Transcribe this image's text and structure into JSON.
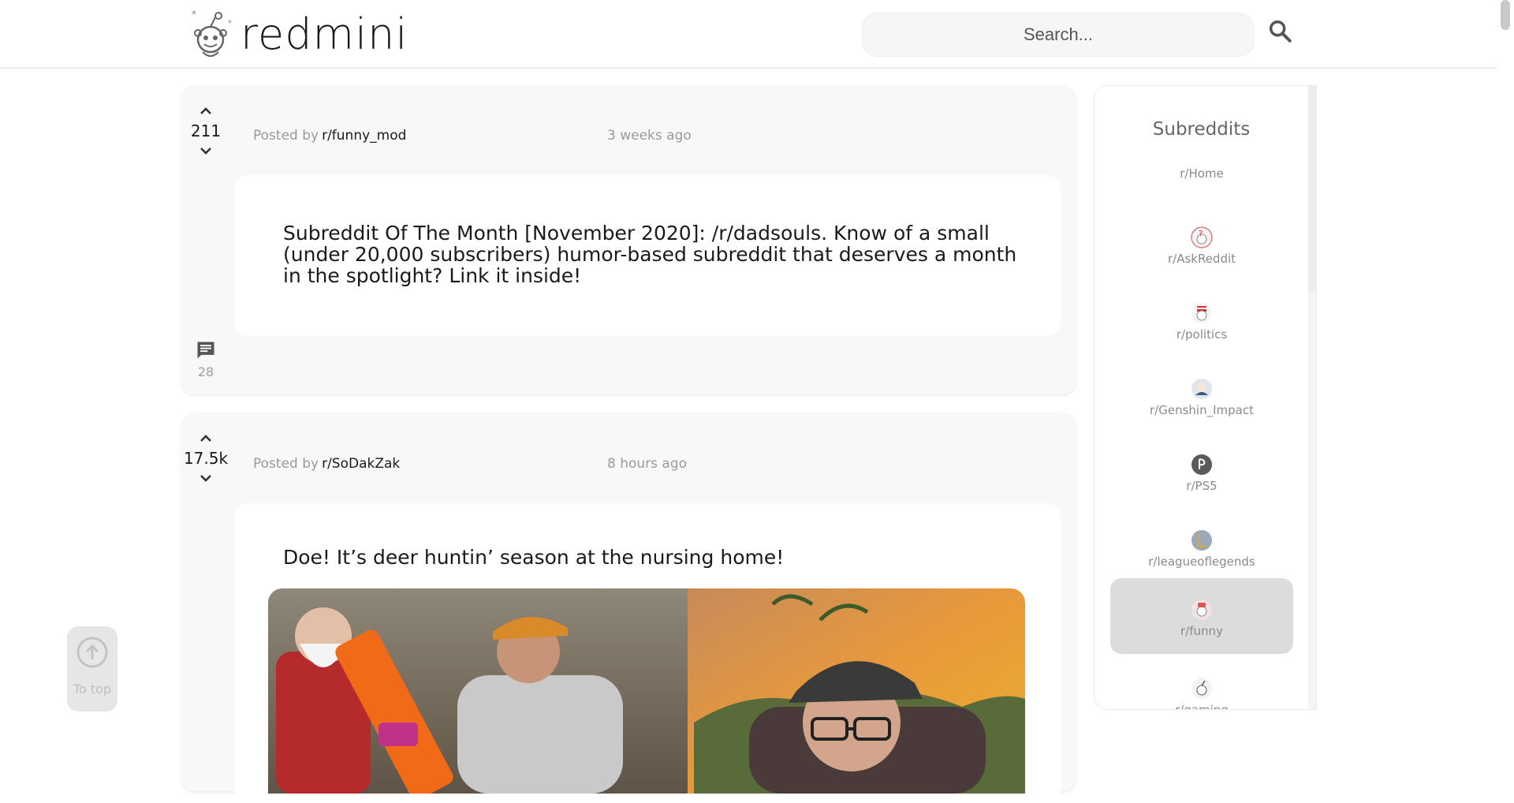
{
  "header": {
    "logo_text": "redmini",
    "search_placeholder": "Search..."
  },
  "posts": [
    {
      "score": "211",
      "posted_by_label": "Posted by",
      "author": "r/funny_mod",
      "time": "3 weeks ago",
      "title": "Subreddit Of The Month [November 2020]: /r/dadsouls. Know of a small (under 20,000 subscribers) humor-based subreddit that deserves a month in the spotlight? Link it inside!",
      "comments": "28"
    },
    {
      "score": "17.5k",
      "posted_by_label": "Posted by",
      "author": "r/SoDakZak",
      "time": "8 hours ago",
      "title": "Doe! It’s deer huntin’ season at the nursing home!"
    }
  ],
  "sidebar": {
    "title": "Subreddits",
    "items": [
      {
        "label": "r/Home"
      },
      {
        "label": "r/AskReddit"
      },
      {
        "label": "r/politics"
      },
      {
        "label": "r/Genshin_Impact"
      },
      {
        "label": "r/PS5"
      },
      {
        "label": "r/leagueoflegends"
      },
      {
        "label": "r/funny"
      },
      {
        "label": "r/gaming"
      }
    ]
  },
  "to_top": {
    "label": "To top"
  },
  "colors": {
    "accent_bg": "#f8f8f8",
    "active_item": "#dcdcdc",
    "muted_text": "#9a9a9a"
  }
}
